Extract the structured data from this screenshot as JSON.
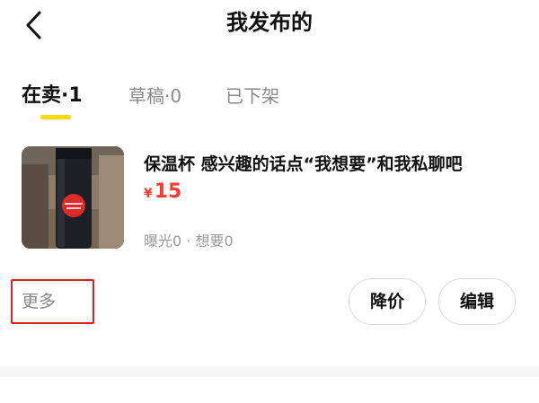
{
  "header": {
    "title": "我发布的",
    "back_icon": "chevron-left-icon"
  },
  "tabs": [
    {
      "name": "在卖",
      "count": "1",
      "label": "在卖·1",
      "active": true
    },
    {
      "name": "草稿",
      "count": "0",
      "label": "草稿·0",
      "active": false
    },
    {
      "name": "已下架",
      "count": null,
      "label": "已下架",
      "active": false
    }
  ],
  "item": {
    "title": "保温杯 感兴趣的话点“我想要”和我私聊吧",
    "price_symbol": "¥",
    "price": "15",
    "stats": "曝光0 · 想要0"
  },
  "actions": {
    "more_label": "更多",
    "reduce_price_label": "降价",
    "edit_label": "编辑"
  },
  "colors": {
    "accent_yellow": "#ffda00",
    "price_red": "#ff3b30",
    "highlight_red": "#e02020",
    "muted_text": "#8a8a8a"
  }
}
